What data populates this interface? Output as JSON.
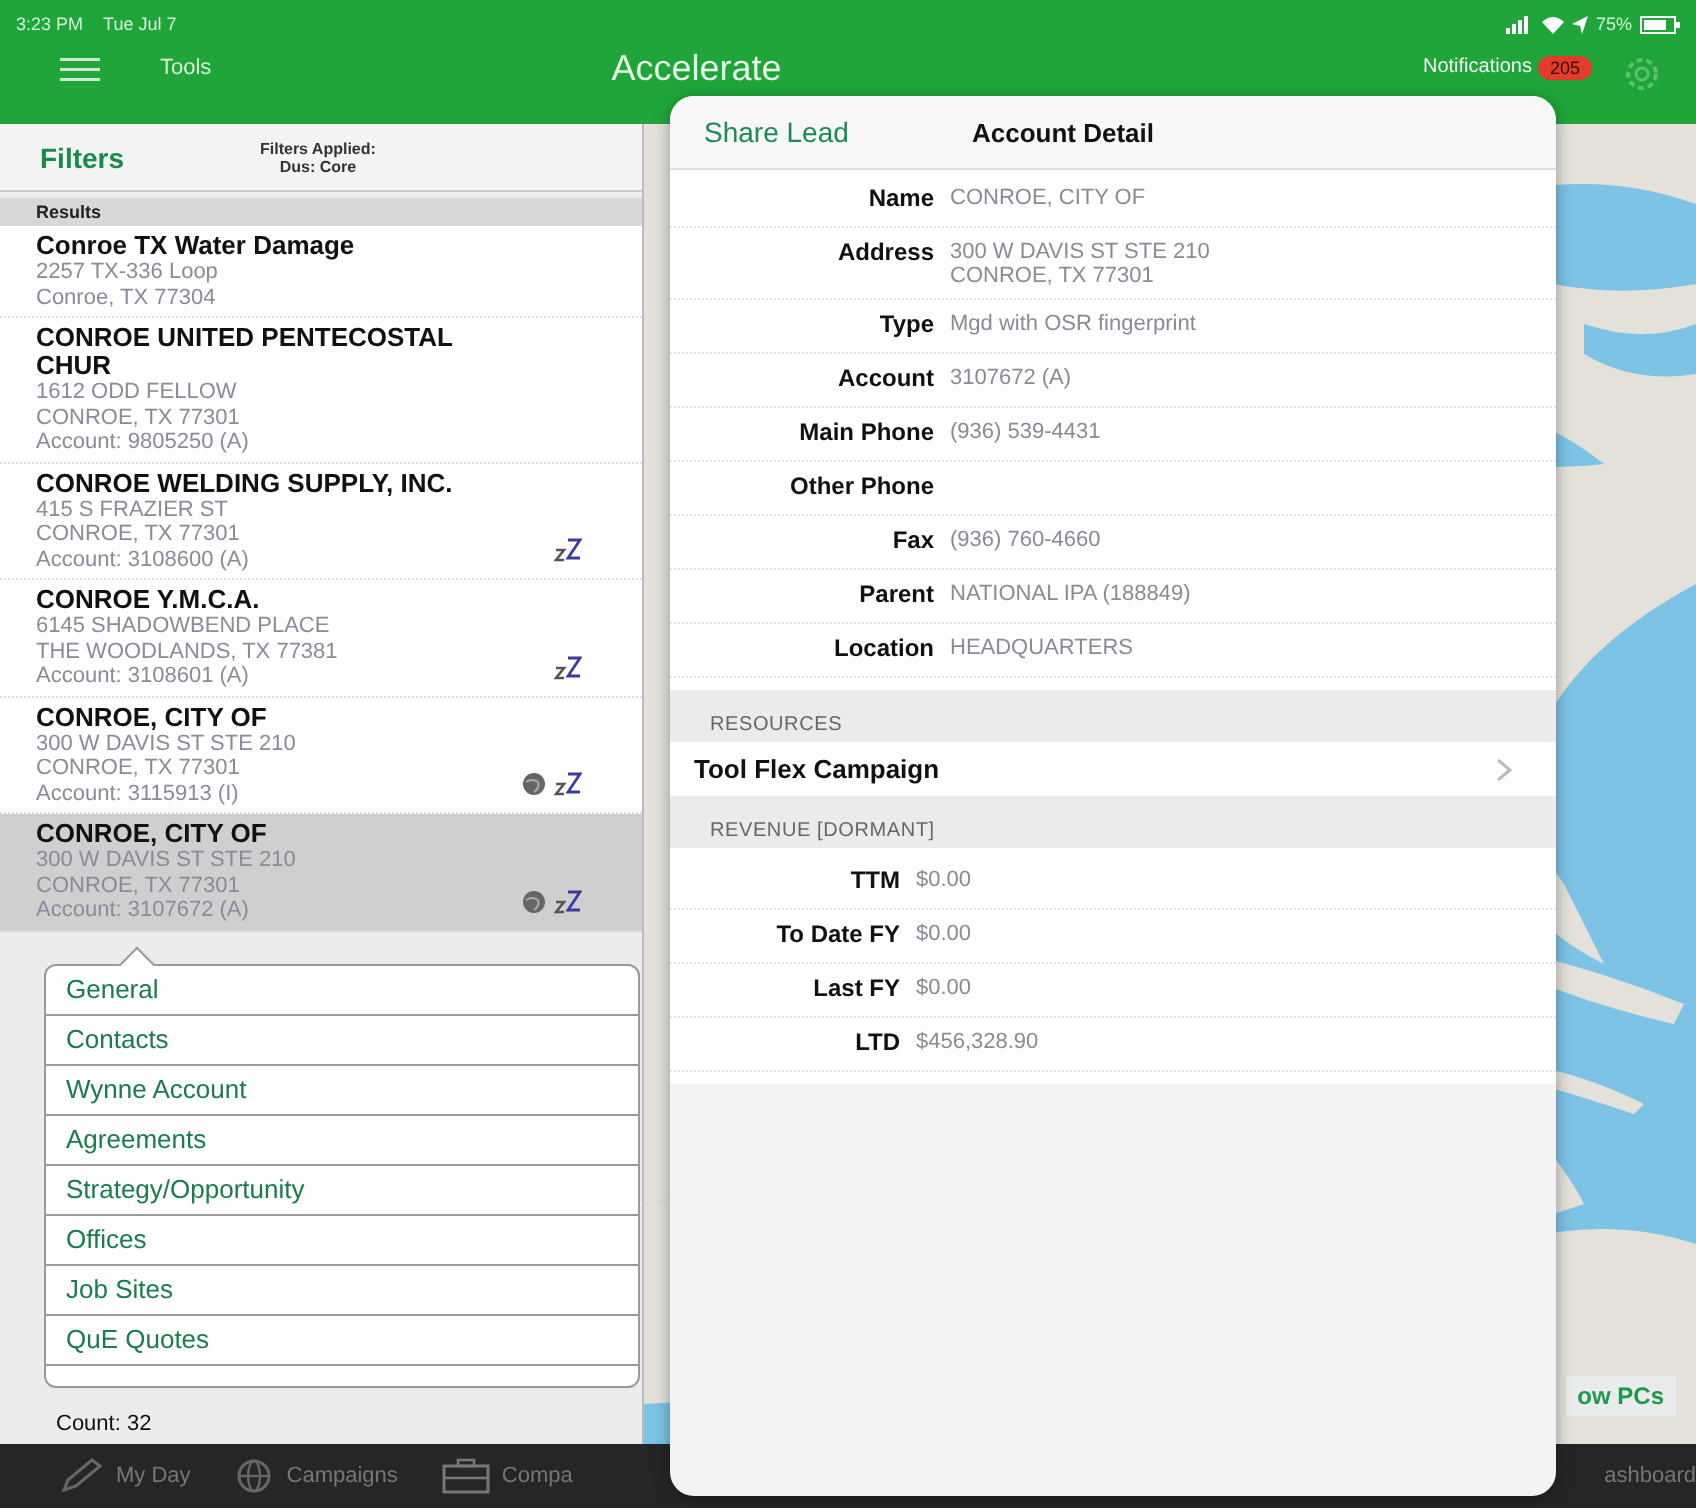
{
  "status_bar": {
    "time": "3:23 PM",
    "date": "Tue Jul 7",
    "battery": "75%"
  },
  "header": {
    "tools": "Tools",
    "title": "Accelerate",
    "notifications": "Notifications",
    "badge": "205"
  },
  "filters": {
    "label": "Filters",
    "applied": "Filters Applied:",
    "value": "Dus: Core"
  },
  "results": {
    "heading": "Results",
    "items": [
      {
        "name": "Conroe TX Water Damage",
        "lines": [
          "2257 TX-336 Loop",
          "Conroe, TX 77304"
        ],
        "selected": false
      },
      {
        "name": "CONROE UNITED PENTECOSTAL CHUR",
        "lines": [
          "1612 ODD FELLOW",
          "CONROE, TX 77301",
          "Account: 9805250 (A)"
        ],
        "selected": false
      },
      {
        "name": "CONROE WELDING SUPPLY, INC.",
        "lines": [
          "415 S FRAZIER ST",
          "CONROE, TX 77301",
          "Account: 3108600 (A)"
        ],
        "badges": [
          {
            "kind": "sleep"
          }
        ],
        "selected": false
      },
      {
        "name": "CONROE Y.M.C.A.",
        "lines": [
          "6145 SHADOWBEND PLACE",
          "THE WOODLANDS, TX 77381",
          "Account: 3108601 (A)"
        ],
        "badges": [
          {
            "kind": "sleep"
          }
        ],
        "selected": false
      },
      {
        "name": "CONROE, CITY OF",
        "lines": [
          "300 W DAVIS ST STE 210",
          "CONROE, TX 77301",
          "Account: 3115913 (I)"
        ],
        "badges": [
          {
            "kind": "globe"
          },
          {
            "kind": "sleep"
          }
        ],
        "selected": false
      },
      {
        "name": "CONROE, CITY OF",
        "lines": [
          "300 W DAVIS ST STE 210",
          "CONROE, TX 77301",
          "Account: 3107672 (A)"
        ],
        "badges": [
          {
            "kind": "globe"
          },
          {
            "kind": "sleep"
          }
        ],
        "selected": true
      }
    ]
  },
  "menu": {
    "items": [
      "General",
      "Contacts",
      "Wynne Account",
      "Agreements",
      "Strategy/Opportunity",
      "Offices",
      "Job Sites",
      "QuE Quotes"
    ]
  },
  "count": "Count: 32",
  "detail": {
    "share": "Share Lead",
    "title": "Account Detail",
    "fields": [
      {
        "label": "Name",
        "lines": [
          "CONROE, CITY OF"
        ]
      },
      {
        "label": "Address",
        "lines": [
          "300 W DAVIS ST STE 210",
          "CONROE, TX 77301"
        ]
      },
      {
        "label": "Type",
        "lines": [
          "Mgd with OSR fingerprint"
        ]
      },
      {
        "label": "Account",
        "lines": [
          "3107672 (A)"
        ]
      },
      {
        "label": "Main Phone",
        "lines": [
          "(936) 539-4431"
        ]
      },
      {
        "label": "Other Phone"
      },
      {
        "label": "Fax",
        "lines": [
          "(936) 760-4660"
        ]
      },
      {
        "label": "Parent",
        "lines": [
          "NATIONAL IPA (188849)"
        ]
      },
      {
        "label": "Location",
        "lines": [
          "HEADQUARTERS"
        ]
      }
    ],
    "resources": {
      "heading": "RESOURCES",
      "items": [
        "Tool Flex Campaign"
      ]
    },
    "revenue": {
      "heading": "REVENUE [DORMANT]",
      "fields": [
        {
          "label": "TTM",
          "lines": [
            "$0.00"
          ]
        },
        {
          "label": "To Date FY",
          "lines": [
            "$0.00"
          ]
        },
        {
          "label": "Last FY",
          "lines": [
            "$0.00"
          ]
        },
        {
          "label": "LTD",
          "lines": [
            "$456,328.90"
          ]
        }
      ]
    }
  },
  "map": {
    "kind": "picture",
    "button": "ow PCs"
  },
  "tab_bar": [
    {
      "kind": "pencil",
      "label": "My Day"
    },
    {
      "kind": "globe",
      "label": "Campaigns"
    },
    {
      "kind": "briefcase",
      "label": "Compa"
    },
    {
      "kind": "none",
      "label": "ashboard"
    }
  ]
}
